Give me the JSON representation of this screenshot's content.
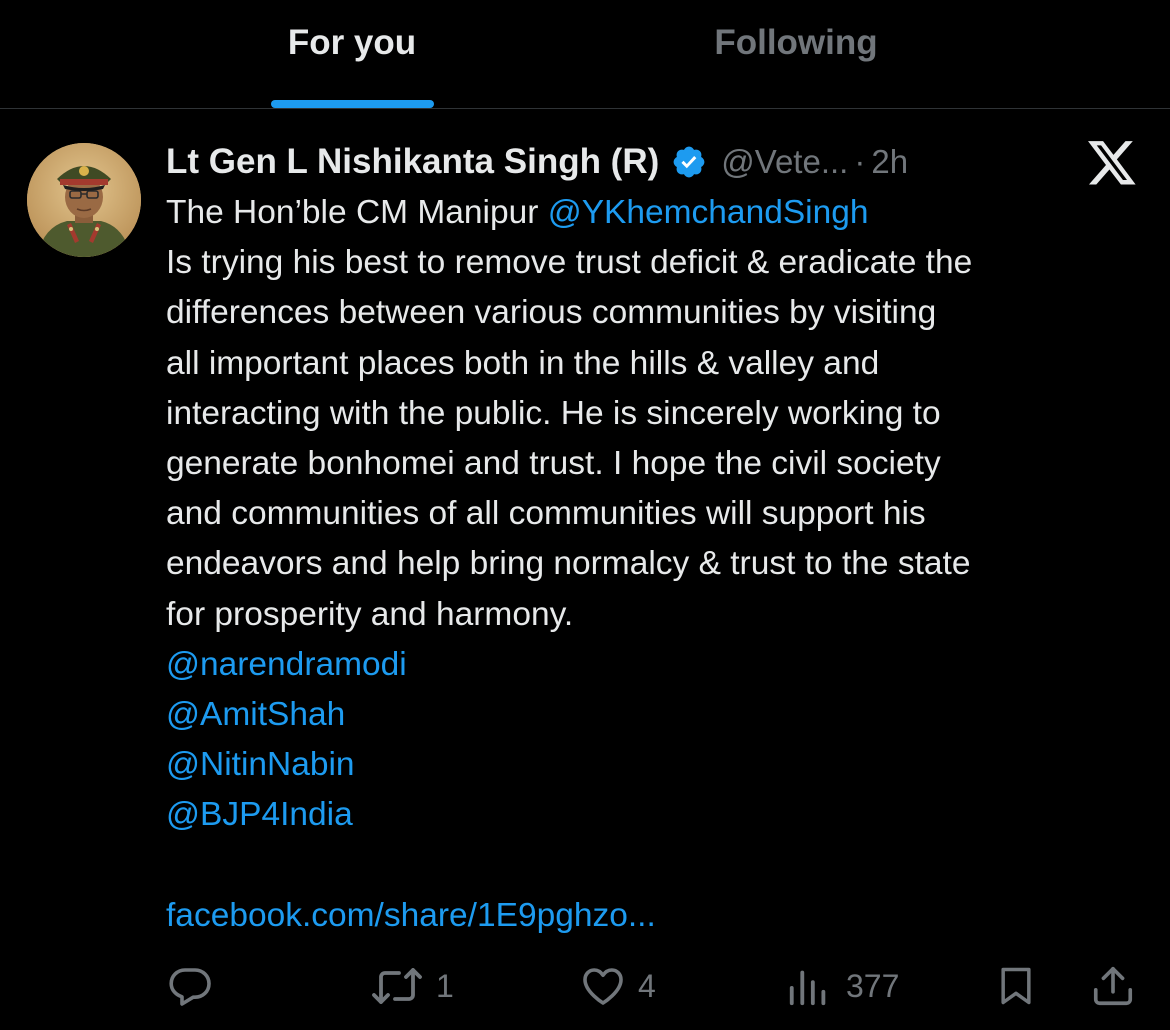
{
  "tabs": {
    "for_you": "For you",
    "following": "Following"
  },
  "tweet": {
    "author_name": "Lt Gen L Nishikanta Singh (R)",
    "handle": "@Vete...",
    "separator": "·",
    "time": "2h",
    "lines": {
      "l1_text": "The Hon’ble CM Manipur ",
      "l1_mention": "@YKhemchandSingh",
      "l2": "Is trying his best to remove trust deficit & eradicate the",
      "l3": "differences between various communities by visiting",
      "l4": "all important places both in the hills & valley and",
      "l5": "interacting with the public.  He is sincerely working to",
      "l6": "generate bonhomei and trust. I hope the civil society",
      "l7": "and communities of all communities will support his",
      "l8": "endeavors and help bring normalcy & trust to the state",
      "l9": "for prosperity and harmony.",
      "m1": "@narendramodi",
      "m2": "@AmitShah",
      "m3": "@NitinNabin",
      "m4": "@BJP4India",
      "link": "facebook.com/share/1E9pghzo..."
    },
    "actions": {
      "reply_icon": "reply-icon",
      "retweet_count": "1",
      "like_count": "4",
      "views_count": "377"
    }
  },
  "colors": {
    "background": "#000000",
    "text": "#e7e9ea",
    "muted": "#71767b",
    "accent": "#1d9bf0",
    "divider": "#2f3336"
  }
}
